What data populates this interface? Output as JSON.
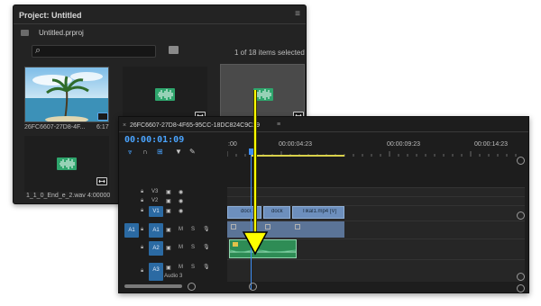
{
  "project_panel": {
    "title": "Project: Untitled",
    "file_name": "Untitled.prproj",
    "search_placeholder": "",
    "items_selected": "1 of 18 items selected",
    "items": [
      {
        "name": "26FC6607-27D8-4F...",
        "duration": "6:17"
      },
      {
        "name": "",
        "duration": ""
      },
      {
        "name": "",
        "duration": ""
      },
      {
        "name": "1_1_0_End_e_2.wav",
        "duration": "4:00000"
      }
    ]
  },
  "timeline_panel": {
    "sequence_title": "26FC6607-27D8-4F65-95CC-18DC824C9C29",
    "timecode": "00:00:01:09",
    "ruler_labels": [
      ":00",
      "00:00:04:23",
      "00:00:09:23",
      "00:00:14:23"
    ],
    "tracks": [
      {
        "label": "V3"
      },
      {
        "label": "V2"
      },
      {
        "label": "V1"
      },
      {
        "label": "A1",
        "source": "A1",
        "m": "M",
        "s": "S"
      },
      {
        "label": "A2",
        "m": "M",
        "s": "S"
      },
      {
        "label": "A3",
        "name": "Audio 3",
        "m": "M",
        "s": "S"
      }
    ],
    "video_clips": [
      "dock",
      "dock",
      "Tikal1.mp4 [V]"
    ]
  },
  "colors": {
    "accent_blue": "#3e8ff5",
    "audio_green": "#2ea56c",
    "arrow_yellow": "#ffff00"
  }
}
